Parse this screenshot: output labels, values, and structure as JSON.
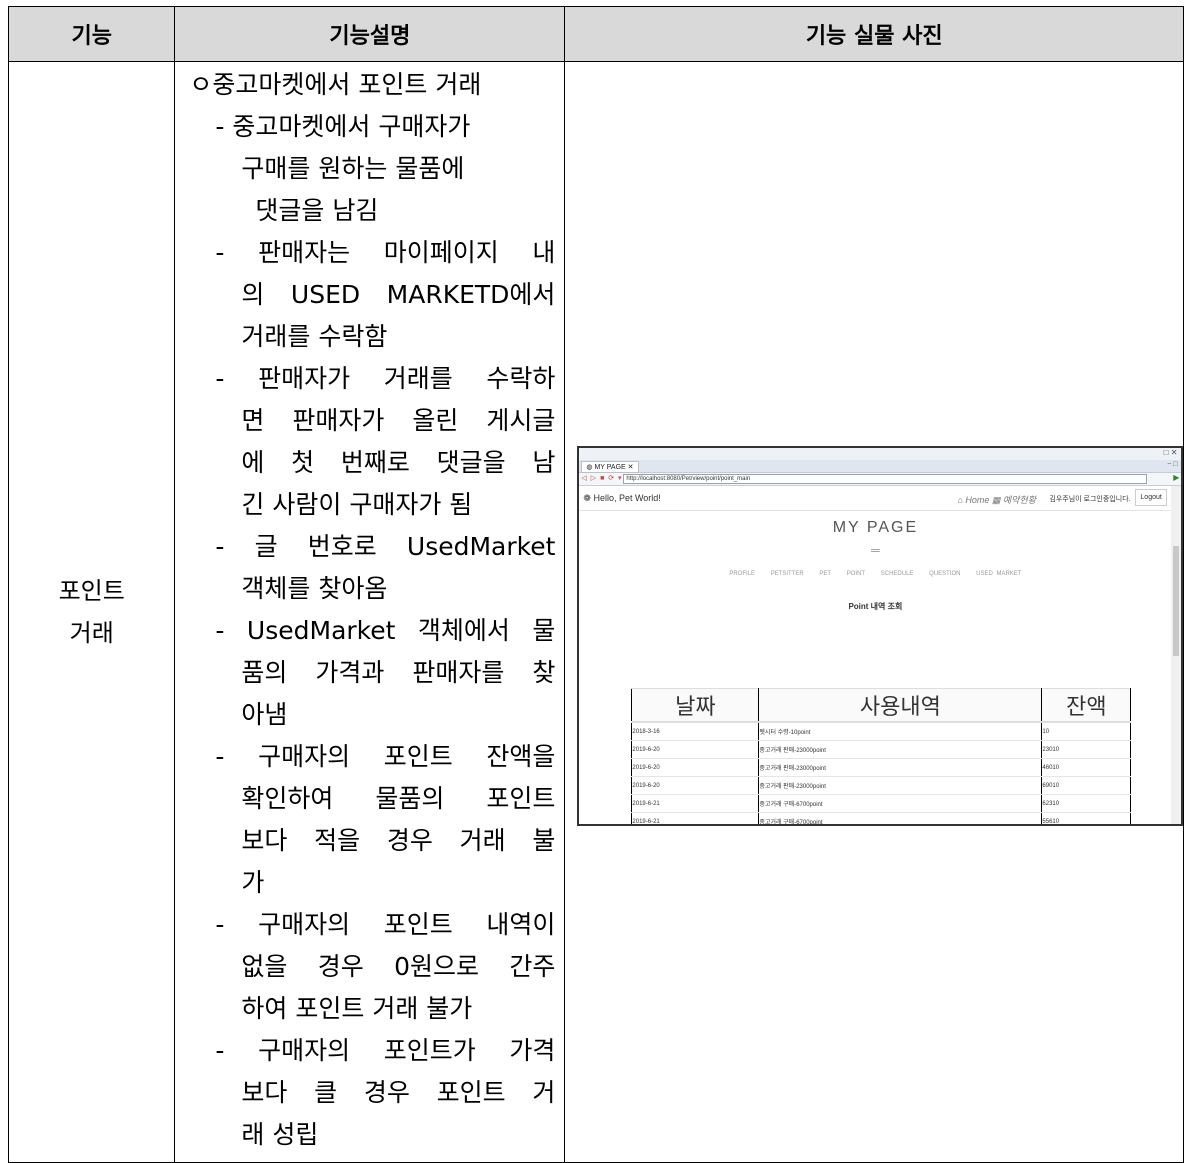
{
  "headers": [
    "기능",
    "기능설명",
    "기능 실물 사진"
  ],
  "function_name": [
    "포인트",
    "거래"
  ],
  "description_lines": [
    "ㅇ중고마켓에서 포인트 거래",
    "- 중고마켓에서 구매자가",
    "구매를 원하는 물품에",
    "댓글을 남김",
    "- 판매자는 마이페이지 내",
    "의 USED MARKETD에서",
    "거래를 수락함",
    "- 판매자가 거래를 수락하",
    "면 판매자가 올린 게시글",
    "에 첫 번째로 댓글을 남",
    "긴 사람이 구매자가 됨",
    "- 글 번호로 UsedMarket",
    "객체를 찾아옴",
    "- UsedMarket 객체에서 물",
    "품의 가격과 판매자를 찾",
    "아냄",
    "- 구매자의 포인트 잔액을",
    "확인하여 물품의 포인트",
    "보다 적을 경우 거래 불",
    "가",
    "- 구매자의 포인트 내역이",
    "없을 경우 0원으로 간주",
    "하여 포인트 거래 불가",
    "- 구매자의 포인트가 가격",
    "보다 클 경우 포인트 거",
    "래 성립"
  ],
  "screenshot": {
    "tab_title": "MY PAGE",
    "url": "http://localhost:8080/Pet/view/point/point_main",
    "brand": "Hello, Pet World!",
    "home": "Home",
    "reservation": "예약현황",
    "login_message": "김우주님이 로그인중입니다.",
    "logout": "Logout",
    "page_title": "MY PAGE",
    "menu": [
      "PROFILE",
      "PETSITTER",
      "PET",
      "POINT",
      "SCHEDULE",
      "QUESTION",
      "USED MARKET"
    ],
    "section_title": "Point 내역 조회",
    "columns": [
      "날짜",
      "사용내역",
      "잔액"
    ],
    "rows": [
      [
        "2018-3-16",
        "펫시터 수령-10point",
        "10"
      ],
      [
        "2019-6-20",
        "중고거래 판매-23000point",
        "23010"
      ],
      [
        "2019-6-20",
        "중고거래 판매-23000point",
        "46010"
      ],
      [
        "2019-6-20",
        "중고거래 판매-23000point",
        "69010"
      ],
      [
        "2019-6-21",
        "중고거래 구매-6700point",
        "62310"
      ],
      [
        "2019-6-21",
        "중고거래 구매-6700point",
        "55610"
      ]
    ]
  }
}
